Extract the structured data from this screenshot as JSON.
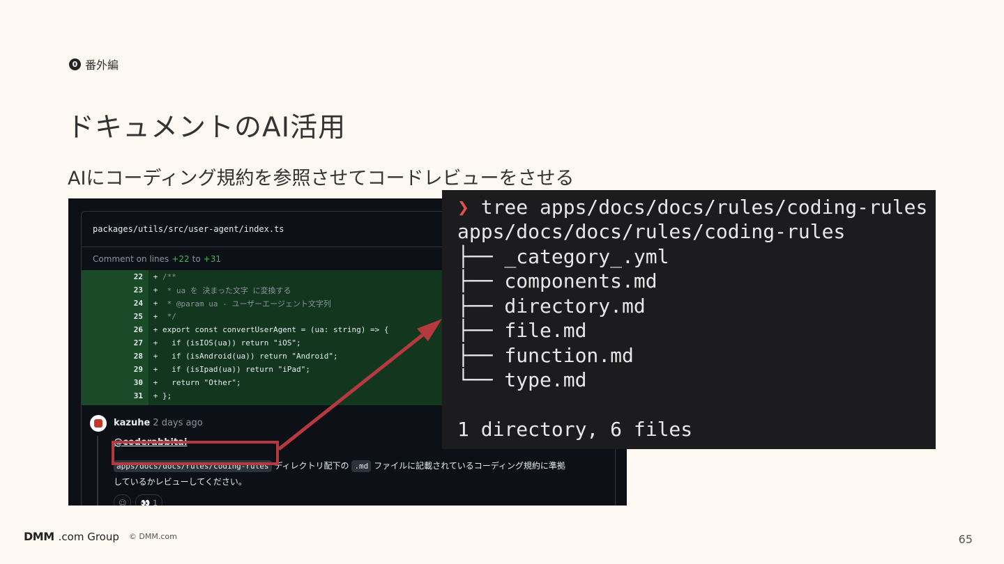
{
  "section": {
    "badge": "0",
    "label": "番外編"
  },
  "title": "ドキュメントのAI活用",
  "subtitle": "AIにコーディング規約を参照させてコードレビューをさせる",
  "github": {
    "file_path": "packages/utils/src/user-agent/index.ts",
    "comment_on": {
      "prefix": "Comment on lines",
      "from": "+22",
      "mid": "to",
      "to": "+31"
    },
    "diff": [
      {
        "ln": "22",
        "code": "/**"
      },
      {
        "ln": "23",
        "code": " * ua を 決まった文字 に変換する"
      },
      {
        "ln": "24",
        "code": " * @param ua - ユーザーエージェント文字列"
      },
      {
        "ln": "25",
        "code": " */"
      },
      {
        "ln": "26",
        "code": "export const convertUserAgent = (ua: string) => {"
      },
      {
        "ln": "27",
        "code": "  if (isIOS(ua)) return \"iOS\";"
      },
      {
        "ln": "28",
        "code": "  if (isAndroid(ua)) return \"Android\";"
      },
      {
        "ln": "29",
        "code": "  if (isIpad(ua)) return \"iPad\";"
      },
      {
        "ln": "30",
        "code": "  return \"Other\";"
      },
      {
        "ln": "31",
        "code": "};"
      }
    ],
    "author": "kazuhe",
    "time": "2 days ago",
    "mention": "@coderabbitai",
    "comment_path": "apps/docs/docs/rules/coding-rules",
    "comment_text1": "ディレクトリ配下の",
    "comment_chip": ".md",
    "comment_text2": "ファイルに記載されているコーディング規約に準拠",
    "comment_text3": "しているかレビューしてください。",
    "reaction_count": "1"
  },
  "terminal": {
    "lines": [
      "tree apps/docs/docs/rules/coding-rules",
      "apps/docs/docs/rules/coding-rules",
      "├── _category_.yml",
      "├── components.md",
      "├── directory.md",
      "├── file.md",
      "├── function.md",
      "└── type.md",
      "1 directory, 6 files"
    ],
    "prompt": "❯"
  },
  "footer": {
    "brand": "DMM",
    "brand_suffix": ".com Group",
    "copyright": "© DMM.com",
    "page": "65"
  },
  "colors": {
    "accent": "#b53a3f",
    "background": "#fdf8f2"
  }
}
